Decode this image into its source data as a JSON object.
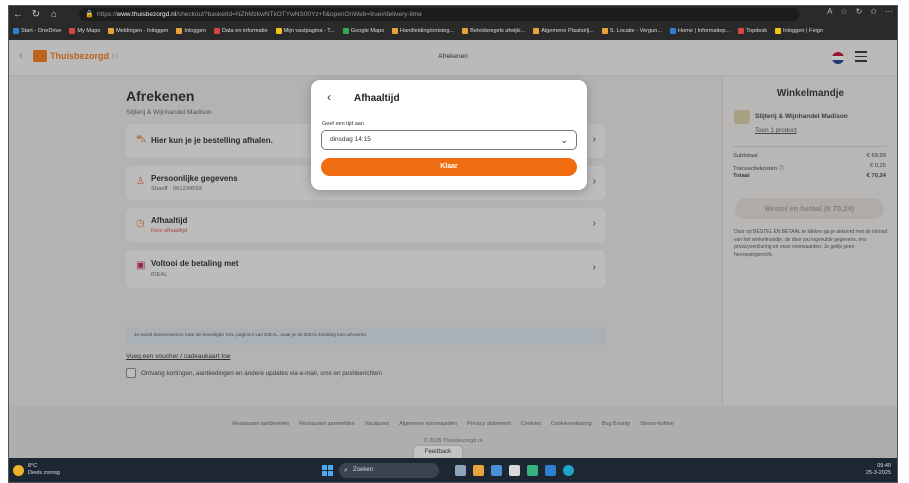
{
  "browser": {
    "url_prefix": "https://",
    "url_domain": "www.thuisbezorgd.nl",
    "url_path": "/checkout?basketId=NZhMzkwNTkOTYwNS00Yz+fi&openOnWeb=true#delivery-time",
    "bookmarks": [
      "Start - OneDrive",
      "My Maps",
      "Meldingen - Inloggen",
      "Inloggen",
      "Data en informatie",
      "Mijn vastpagina - T...",
      "Google Maps",
      "Handleiding/ontsteg...",
      "Beleidsregels afwijki...",
      "Algemene Plaatsélj...",
      "S. Locatie - Vergun...",
      "Home | Informatiep...",
      "Topdesk",
      "Inloggen | Feign"
    ],
    "bookmark_colors": [
      "#2f80d1",
      "#d64541",
      "#e6a23c",
      "#e6a23c",
      "#d64541",
      "#f0c419",
      "#34a853",
      "#e6a23c",
      "#e6a23c",
      "#e6a23c",
      "#e6a23c",
      "#2f80d1",
      "#d64541",
      "#f0c419"
    ]
  },
  "header": {
    "logo_text": "Thuisbezorgd",
    "logo_suffix": ".nl",
    "title": "Afrekenen"
  },
  "checkout": {
    "title": "Afrekenen",
    "restaurant": "Slijterij & Wijnhandel Madison",
    "cards": [
      {
        "icon": "bag-icon",
        "title": "Hier kun je je bestelling afhalen.",
        "subtitle": ""
      },
      {
        "icon": "person-icon",
        "title": "Persoonlijke gegevens",
        "subtitle": "Shariff · 061234593"
      },
      {
        "icon": "clock-icon",
        "title": "Afhaaltijd",
        "subtitle": "Kies afhaaltijd"
      },
      {
        "icon": "ideal-icon",
        "title": "Voltooi de betaling met",
        "subtitle": "iDEAL"
      }
    ],
    "ideal_note": "Je wordt doorverwezen naar de beveiligde SSL-pagina's van iDEAL, waar je de iDEAL-betaling kan uitvoeren.",
    "voucher_link": "Voeg een voucher / cadeaukaart toe",
    "optin_label": "Ontvang kortingen, aanbiedingen en andere updates via e-mail, sms en pushberichten"
  },
  "basket": {
    "title": "Winkelmandje",
    "restaurant": "Slijterij & Wijnhandel Madison",
    "product_link": "Toon 1 product",
    "summary": [
      {
        "label": "Subtotaal",
        "value": "€ 69,99"
      },
      {
        "label": "Transactiekosten ⓘ",
        "value": "€ 0,25"
      },
      {
        "label": "Totaal",
        "value": "€ 70,24"
      }
    ],
    "order_button": "Bestel en betaal (€ 70,24)",
    "legal_text": "Door op BESTEL EN BETAAL te klikken ga je akkoord met de inhoud van het winkelmandje, de door jou ingevulde gegevens, ons privacyverklaring en onze voorwaarden. Je gelijk geen herroepingsrecht."
  },
  "footer": {
    "links": [
      "Restaurant aanbevelen",
      "Restaurant aanmelden",
      "Vacatures",
      "Algemene voorwaarden",
      "Privacy statement",
      "Cookies",
      "Cookieverklaring",
      "Bug Bounty",
      "Stress-hotline"
    ],
    "copyright": "© 2025 Thuisbezorgd.nl",
    "feedback": "Feedback"
  },
  "modal": {
    "title": "Afhaaltijd",
    "label": "Geef een tijd aan",
    "selected_time": "dinsdag 14:15",
    "done_button": "Klaar"
  },
  "taskbar": {
    "temp": "8°C",
    "weather": "Deels zonnig",
    "search": "Zoeken",
    "time": "09:40",
    "date": "25-3-2025"
  }
}
